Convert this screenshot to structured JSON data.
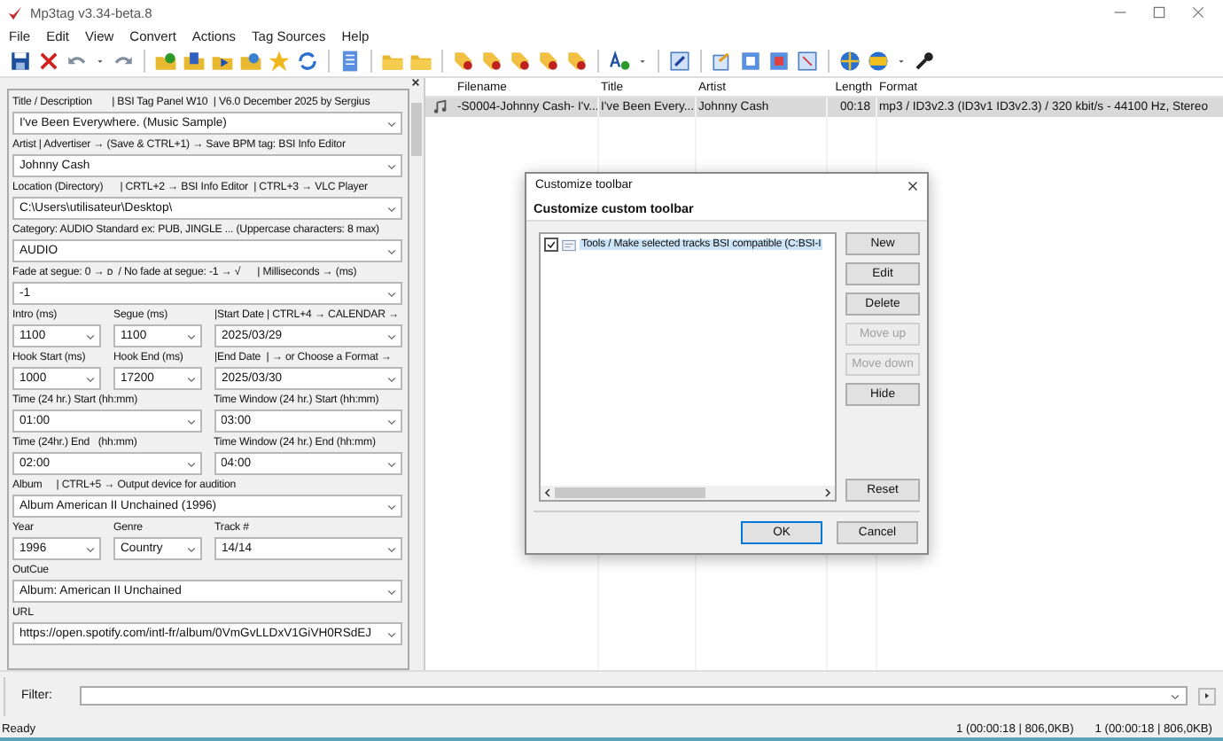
{
  "window": {
    "title": "Mp3tag v3.34-beta.8"
  },
  "menu": [
    "File",
    "Edit",
    "View",
    "Convert",
    "Actions",
    "Tag Sources",
    "Help"
  ],
  "tag_panel": {
    "rows": [
      [
        {
          "label": "Title / Description       | BSI Tag Panel W10  | V6.0 December 2025 by Sergius",
          "value": "I've Been Everywhere. (Music Sample)"
        }
      ],
      [
        {
          "label": "Artist | Advertiser → (Save & CTRL+1) → Save BPM tag: BSI Info Editor",
          "value": "Johnny Cash"
        }
      ],
      [
        {
          "label": "Location (Directory)      | CRTL+2 → BSI Info Editor  | CTRL+3 → VLC Player",
          "value": "C:\\Users\\utilisateur\\Desktop\\"
        }
      ],
      [
        {
          "label": "Category: AUDIO Standard ex: PUB, JINGLE ... (Uppercase characters: 8 max)",
          "value": "AUDIO"
        }
      ],
      [
        {
          "label": "Fade at segue: 0 → ᴅ  / No fade at segue: -1 → √      | Milliseconds → (ms)",
          "value": "-1"
        }
      ],
      [
        {
          "label": "Intro (ms)",
          "value": "1100"
        },
        {
          "label": "Segue (ms)",
          "value": "1100"
        },
        {
          "label": "|Start Date | CTRL+4 → CALENDAR →",
          "value": "2025/03/29"
        }
      ],
      [
        {
          "label": "Hook Start (ms)",
          "value": "1000"
        },
        {
          "label": "Hook End (ms)",
          "value": "17200"
        },
        {
          "label": "|End Date  | → or Choose a Format →",
          "value": "2025/03/30"
        }
      ],
      [
        {
          "label": "Time (24 hr.) Start (hh:mm)",
          "value": "01:00"
        },
        {
          "label": "Time Window (24 hr.) Start (hh:mm)",
          "value": "03:00"
        }
      ],
      [
        {
          "label": "Time (24hr.) End   (hh:mm)",
          "value": "02:00"
        },
        {
          "label": "Time Window (24 hr.) End (hh:mm)",
          "value": "04:00"
        }
      ],
      [
        {
          "label": "Album     | CTRL+5 → Output device for audition",
          "value": "Album American II Unchained (1996)"
        }
      ],
      [
        {
          "label": "Year",
          "value": "1996"
        },
        {
          "label": "Genre",
          "value": "Country"
        },
        {
          "label": "Track #",
          "value": "14/14"
        }
      ],
      [
        {
          "label": "OutCue",
          "value": "Album: American II Unchained"
        }
      ],
      [
        {
          "label": "URL",
          "value": "https://open.spotify.com/intl-fr/album/0VmGvLLDxV1GiVH0RSdEJ"
        }
      ]
    ]
  },
  "file_list": {
    "columns": [
      "Filename",
      "Title",
      "Artist",
      "Length",
      "Format"
    ],
    "rows": [
      {
        "cells": [
          "-S0004-Johnny Cash- I'v...",
          "I've Been Every...",
          "Johnny Cash",
          "00:18",
          "mp3 / ID3v2.3 (ID3v1 ID3v2.3) / 320 kbit/s - 44100 Hz, Stereo"
        ],
        "selected": true
      }
    ]
  },
  "dialog": {
    "title": "Customize toolbar",
    "heading": "Customize custom toolbar",
    "items": [
      {
        "label": "Tools / Make selected tracks BSI compatible (C:BSI-I",
        "checked": true,
        "selected": true
      }
    ],
    "side_buttons": [
      {
        "label": "New",
        "disabled": false
      },
      {
        "label": "Edit",
        "disabled": false
      },
      {
        "label": "Delete",
        "disabled": false
      },
      {
        "label": "Move up",
        "disabled": true
      },
      {
        "label": "Move down",
        "disabled": true
      },
      {
        "label": "Hide",
        "disabled": false
      }
    ],
    "reset": "Reset",
    "footer_buttons": [
      {
        "label": "OK",
        "default": true
      },
      {
        "label": "Cancel",
        "default": false
      }
    ]
  },
  "filter": {
    "label": "Filter:"
  },
  "status_bar": {
    "text": "Ready",
    "counts": [
      "1 (00:00:18 | 806,0KB)",
      "1 (00:00:18 | 806,0KB)"
    ]
  }
}
